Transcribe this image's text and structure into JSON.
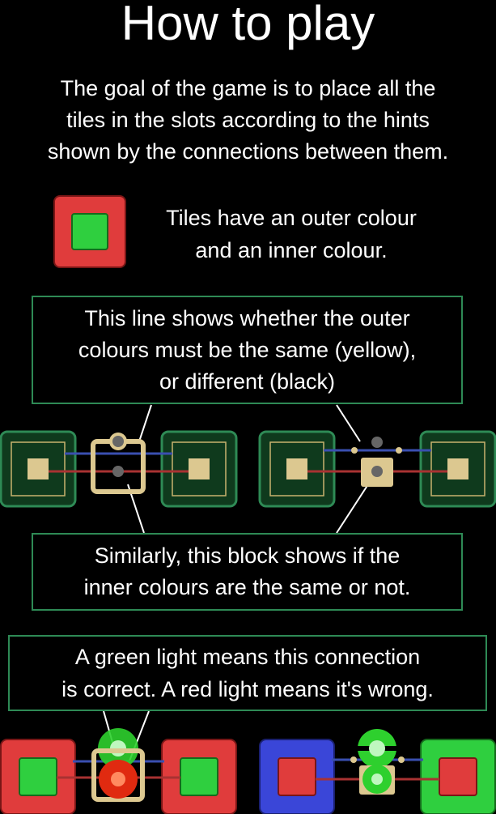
{
  "page": {
    "title": "How to play",
    "intro_lines": [
      "The goal of the game is to place all the",
      "tiles in the slots according to the hints",
      "shown by the connections between them."
    ]
  },
  "tile_section": {
    "lines": [
      "Tiles have an outer colour",
      "and an inner colour."
    ]
  },
  "outer_callout": {
    "lines": [
      "This line shows whether the outer",
      "colours must be the same (yellow),",
      "or different (black)"
    ]
  },
  "inner_callout": {
    "lines": [
      "Similarly, this block shows if the",
      "inner colours are the same or not."
    ]
  },
  "light_callout": {
    "lines": [
      "A green light means this connection",
      "is correct. A red light means it's wrong."
    ]
  },
  "colors": {
    "background": "#000000",
    "callout_border": "#2e8a55",
    "tile_red": "#e03c3c",
    "tile_green": "#2fcf3f",
    "tile_blue": "#3a46d8",
    "slot_green": "#0f3a1d",
    "connector_yellow": "#d8c487",
    "light_green": "#35e035",
    "light_red": "#e02a10"
  },
  "icons": [
    "tile-icon",
    "slot-icon",
    "connector-block-icon",
    "status-light-icon"
  ]
}
